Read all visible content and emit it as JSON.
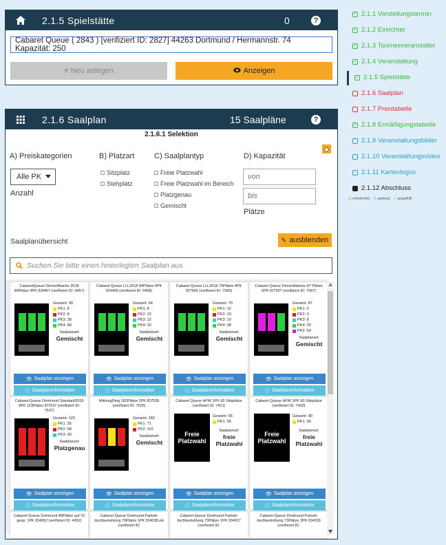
{
  "panel1": {
    "title": "2.1.5 Spielstätte",
    "count": "0",
    "venue_value": "Cabaret Queue ( 2843 ) [verifiziert ID: 2827] 44263 Dortmund / Hermannstr. 74 Kapazität: 250",
    "new_label": "Neu anlegen",
    "show_label": "Anzeigen"
  },
  "panel2": {
    "title": "2.1.6 Saalplan",
    "count": "15 Saalpläne",
    "subhead": "2.1.6.1 Selektion",
    "col_a": "A) Preiskategorien",
    "col_b": "B) Platzart",
    "col_c": "C) Saalplantyp",
    "col_d": "D) Kapazität",
    "pk_select": "Alle PK",
    "anzahl": "Anzahl",
    "platzart": [
      "Sitzplatz",
      "Stehplatz"
    ],
    "plantyp": [
      "Freie Platzwahl",
      "Freie Platzwahl im Bereich",
      "Platzgenau",
      "Gemischt"
    ],
    "von_placeholder": "von",
    "bis_placeholder": "bis",
    "plaetze": "Plätze",
    "overview": "Saalplanübersicht",
    "hide_label": "ausblenden",
    "search_placeholder": "Suchen Sie bitte einen hinterlegten Saalplan aus",
    "btn_show": "Saalplan anzeigen",
    "btn_info": "Saalplaninformation",
    "seat_type_label": "Saalplanart:"
  },
  "cards": [
    {
      "title": "CabaretQueue DinnerAttacke 2018 99Plätze 4PK ID9457 (verifiziert ID: 9457)",
      "stats": [
        {
          "text": "Gesamt: 99",
          "color": ""
        },
        {
          "text": "PK1: 8",
          "color": "#f7e01a"
        },
        {
          "text": "PK2: 8",
          "color": "#e02020"
        },
        {
          "text": "PK3: 28",
          "color": "#2fd0d0"
        },
        {
          "text": "PK4: 48",
          "color": "#3ad13a"
        }
      ],
      "type": "Gemischt",
      "thumb": "green"
    },
    {
      "title": "Cabaret Queue LLL2018 84Plätze 4PK ID9458 (verifiziert ID: 9458)",
      "stats": [
        {
          "text": "Gesamt: 64",
          "color": ""
        },
        {
          "text": "PK1: 8",
          "color": "#f7e01a"
        },
        {
          "text": "PK2: 12",
          "color": "#e02020"
        },
        {
          "text": "PK3: 12",
          "color": "#2fd0d0"
        },
        {
          "text": "PK4: 32",
          "color": "#3ad13a"
        }
      ],
      "type": "Gemischt",
      "thumb": "green"
    },
    {
      "title": "Cabaret Queue LLL2018 70Plätze 4PK ID7999 (verifiziert ID: 7999)",
      "stats": [
        {
          "text": "Gesamt: 70",
          "color": ""
        },
        {
          "text": "PK1: 12",
          "color": "#f7e01a"
        },
        {
          "text": "PK2: 10",
          "color": "#e02020"
        },
        {
          "text": "PK3: 10",
          "color": "#2fd0d0"
        },
        {
          "text": "PK4: 38",
          "color": "#3ad13a"
        }
      ],
      "type": "Gemischt",
      "thumb": "green"
    },
    {
      "title": "Cabaret Queue DinnerAttacke 87 Plätze 5PK ID7997 (verifiziert ID: 7997)",
      "stats": [
        {
          "text": "Gesamt: 87",
          "color": ""
        },
        {
          "text": "PK1: 6",
          "color": "#f7e01a"
        },
        {
          "text": "PK2: 3",
          "color": "#e02020"
        },
        {
          "text": "PK3: 8",
          "color": "#2fd0d0"
        },
        {
          "text": "PK4: 20",
          "color": "#3ad13a"
        },
        {
          "text": "PK5: 50",
          "color": "#d020d0"
        }
      ],
      "type": "Gemischt",
      "thumb": "magenta"
    },
    {
      "title": "Cabaret-Queue Dortmund Standard2018 3PK 123Plätze ID7537 (verifiziert ID: 7537)",
      "stats": [
        {
          "text": "Gesamt: 123",
          "color": ""
        },
        {
          "text": "PK1: 35",
          "color": "#f7e01a"
        },
        {
          "text": "PK2: 68",
          "color": "#e02020"
        },
        {
          "text": "PK3: 20",
          "color": "#2fd0d0"
        }
      ],
      "type": "Platzgenau",
      "thumb": "red"
    },
    {
      "title": "MittsingDing 182Plätze 2PK ID7535 (verifiziert ID: 7535)",
      "stats": [
        {
          "text": "Gesamt: 182",
          "color": ""
        },
        {
          "text": "PK1: 71",
          "color": "#f7e01a"
        },
        {
          "text": "PK2: 110",
          "color": "#e02020"
        }
      ],
      "type": "Gemischt",
      "thumb": "redyellow"
    },
    {
      "title": "Cabaret Queue HFW 1PK 65 Sitzplätze (verifiziert ID: 7421)",
      "stats": [
        {
          "text": "Gesamt: 65",
          "color": ""
        },
        {
          "text": "PK1: 65",
          "color": "#f7e01a"
        }
      ],
      "type": "freie Platzwahl",
      "thumb": "frei"
    },
    {
      "title": "Cabaret Queue HFW 1PK 90 Sitzplätze (verifiziert ID: 7420)",
      "stats": [
        {
          "text": "Gesamt: 90",
          "color": ""
        },
        {
          "text": "PK1: 90",
          "color": "#f7e01a"
        }
      ],
      "type": "freie Platzwahl",
      "thumb": "frei"
    }
  ],
  "cards_bottom": [
    "Cabaret-Queue Dortmund 80Plätze auf 70 gesp. 1PK ID4952 (verifiziert ID: 4952)",
    "Cabaret-Queue Dortmund Parkett-tischbestuhlung 70Plätze 1PK ID4038.xls (verifiziert ID:",
    "Cabaret-Queue Dortmund Parkett-tischbestuhlung 73Plätze 1PK ID4037 (verifiziert ID:",
    "Cabaret-Queue Dortmund Parkett-tischbestuhlung 73Plätze 3PK ID4039 (verifiziert ID:"
  ],
  "frei_text": "Freie Platzwahl",
  "sidebar": {
    "items": [
      {
        "label": "2.1.1 Vorstellungstermin",
        "color": "#3cb53c",
        "mark": "✓"
      },
      {
        "label": "2.1.2 Einrichter",
        "color": "#3cb53c",
        "mark": "✓"
      },
      {
        "label": "2.1.3 Tourneeveranstalter",
        "color": "#3cb53c",
        "mark": "✓"
      },
      {
        "label": "2.1.4 Veranstaltung",
        "color": "#3cb53c",
        "mark": "✓"
      },
      {
        "label": "2.1.5 Spielstätte",
        "color": "#3cb53c",
        "mark": "✓"
      },
      {
        "label": "2.1.6 Saalplan",
        "color": "#e0303a",
        "mark": ""
      },
      {
        "label": "2.1.7 Preistabelle",
        "color": "#e0303a",
        "mark": ""
      },
      {
        "label": "2.1.8 Ermäßigungstabelle",
        "color": "#3cb53c",
        "mark": "✓"
      },
      {
        "label": "2.1.9 Veranstaltungsbilder",
        "color": "#2aa0c8",
        "mark": ""
      },
      {
        "label": "2.1.10 Veranstaltungsvideo",
        "color": "#2aa0c8",
        "mark": ""
      },
      {
        "label": "2.1.11 Kartenlogos",
        "color": "#2aa0c8",
        "mark": ""
      },
      {
        "label": "2.1.12 Abschluss",
        "color": "#222222",
        "mark": "■"
      }
    ],
    "legend": [
      "erforderlich,",
      "optional,",
      "ausgefüllt"
    ]
  }
}
